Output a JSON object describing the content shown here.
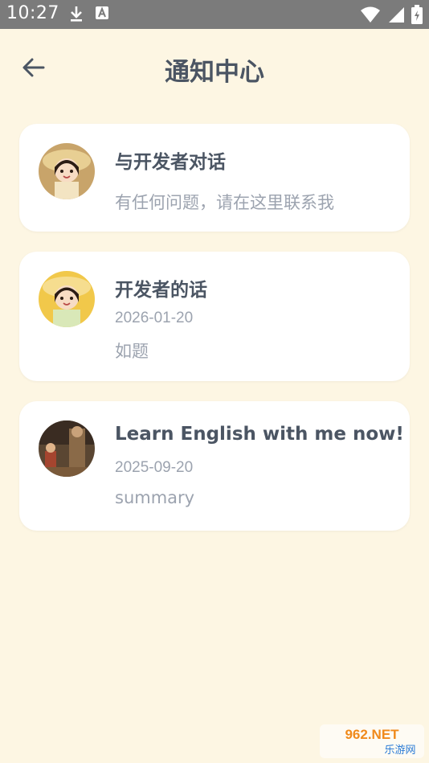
{
  "status_bar": {
    "time": "10:27",
    "left_icons": [
      "download-icon",
      "a-notification-icon"
    ],
    "right_icons": [
      "wifi-icon",
      "signal-icon",
      "battery-icon"
    ]
  },
  "header": {
    "title": "通知中心",
    "back_icon": "arrow-left-icon"
  },
  "notifications": [
    {
      "title": "与开发者对话",
      "date": "",
      "summary": "有任何问题，请在这里联系我",
      "avatar": "girl-avatar"
    },
    {
      "title": "开发者的话",
      "date": "2026-01-20",
      "summary": "如题",
      "avatar": "girl-avatar"
    },
    {
      "title": "Learn English with me now!",
      "date": "2025-09-20",
      "summary": "summary",
      "avatar": "painting-avatar"
    }
  ],
  "watermark": {
    "top": "962.NET",
    "bottom": "乐游网"
  },
  "colors": {
    "background": "#fdf6e3",
    "card": "#ffffff",
    "title_text": "#4b5563",
    "secondary_text": "#9ca3af",
    "status_bar": "#7b7b7b"
  }
}
